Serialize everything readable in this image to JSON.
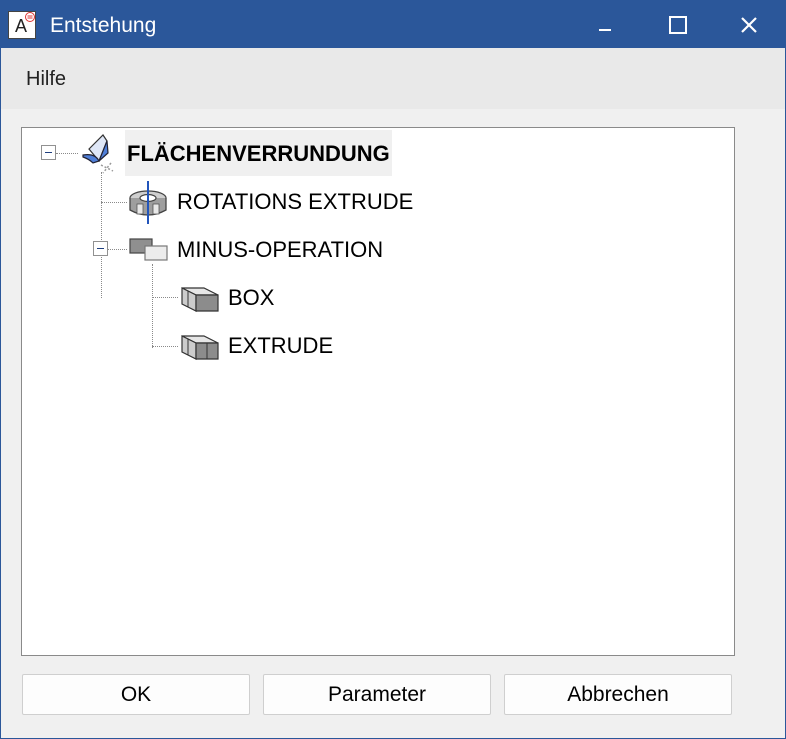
{
  "window": {
    "title": "Entstehung"
  },
  "menu": {
    "items": [
      {
        "label": "Hilfe"
      }
    ]
  },
  "tree": {
    "root": {
      "label": "FLÄCHENVERRUNDUNG",
      "icon": "fillet-surface-icon"
    },
    "children": [
      {
        "label": "ROTATIONS EXTRUDE",
        "icon": "rotation-extrude-icon"
      },
      {
        "label": "MINUS-OPERATION",
        "icon": "subtract-operation-icon",
        "children": [
          {
            "label": "BOX",
            "icon": "box-solid-icon"
          },
          {
            "label": "EXTRUDE",
            "icon": "extrude-solid-icon"
          }
        ]
      }
    ]
  },
  "buttons": {
    "ok": "OK",
    "parameter": "Parameter",
    "cancel": "Abbrechen"
  },
  "colors": {
    "titlebar": "#2b579a",
    "accent": "#4f7fd8"
  }
}
